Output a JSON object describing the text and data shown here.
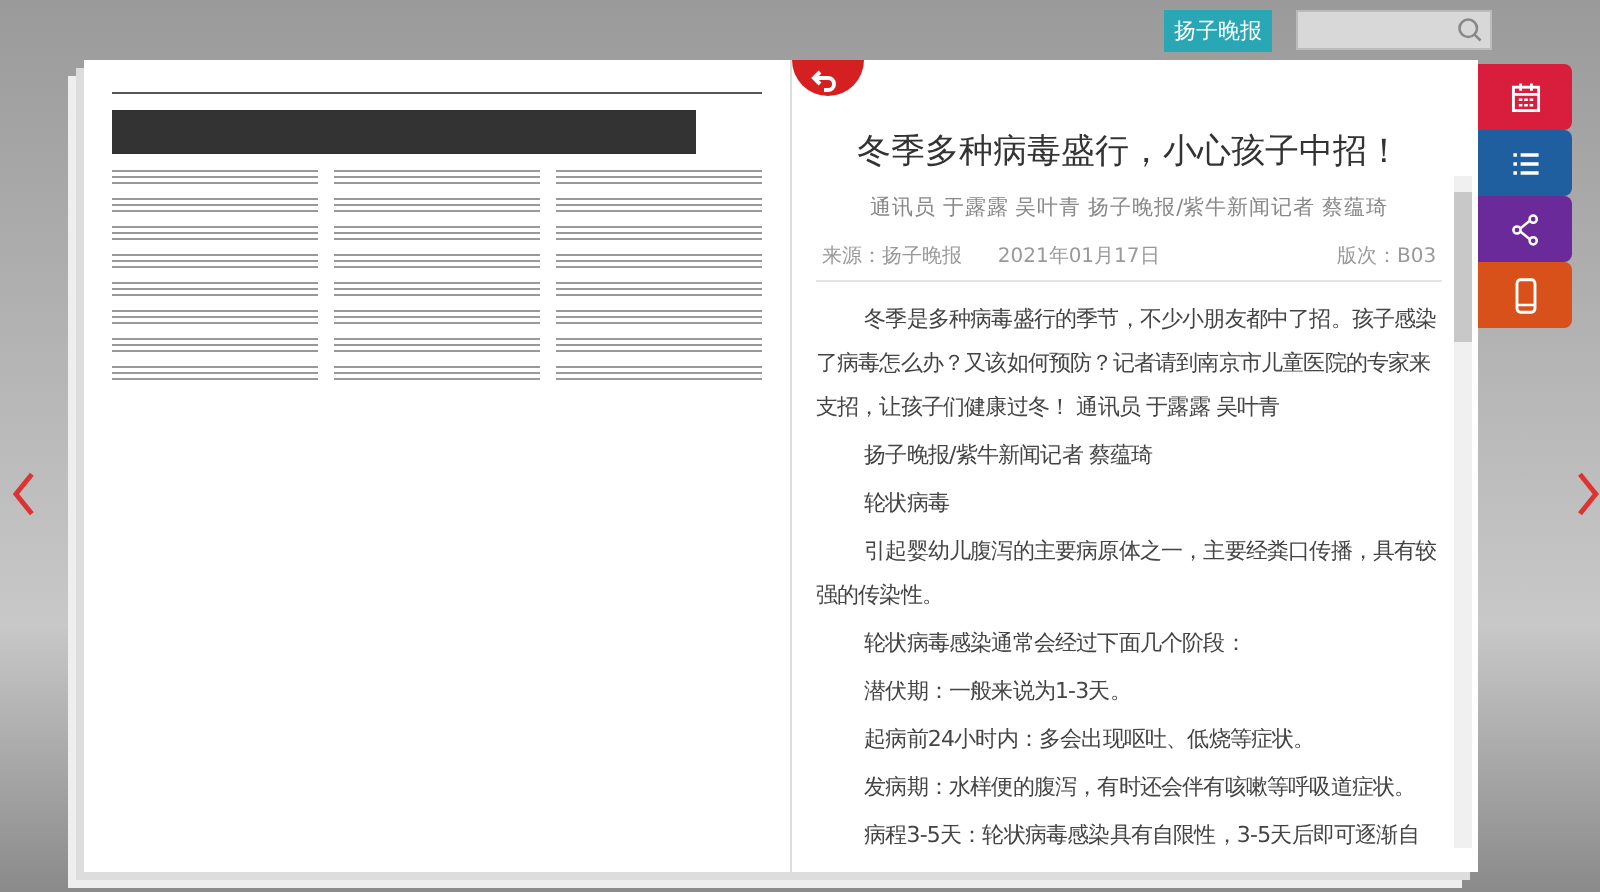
{
  "topbar": {
    "paper_button": "扬子晚报"
  },
  "article": {
    "title": "冬季多种病毒盛行，小心孩子中招！",
    "byline": "通讯员 于露露 吴叶青 扬子晚报/紫牛新闻记者 蔡蕴琦",
    "source": "来源：扬子晚报",
    "date": "2021年01月17日",
    "edition": "版次：B03",
    "paragraphs": [
      "冬季是多种病毒盛行的季节，不少小朋友都中了招。孩子感染了病毒怎么办？又该如何预防？记者请到南京市儿童医院的专家来支招，让孩子们健康过冬！ 通讯员 于露露 吴叶青",
      "扬子晚报/紫牛新闻记者 蔡蕴琦",
      "轮状病毒",
      "引起婴幼儿腹泻的主要病原体之一，主要经粪口传播，具有较强的传染性。",
      "轮状病毒感染通常会经过下面几个阶段：",
      "潜伏期：一般来说为1-3天。",
      "起病前24小时内：多会出现呕吐、低烧等症状。",
      "发病期：水样便的腹泻，有时还会伴有咳嗽等呼吸道症状。",
      "病程3-5天：轮状病毒感染具有自限性，3-5天后即可逐渐自"
    ]
  },
  "side_tabs": [
    {
      "kind": "calendar",
      "color": "#d81e3c"
    },
    {
      "kind": "list",
      "color": "#1f5fa0"
    },
    {
      "kind": "share",
      "color": "#6a2a9a"
    },
    {
      "kind": "phone",
      "color": "#d8501a"
    }
  ]
}
